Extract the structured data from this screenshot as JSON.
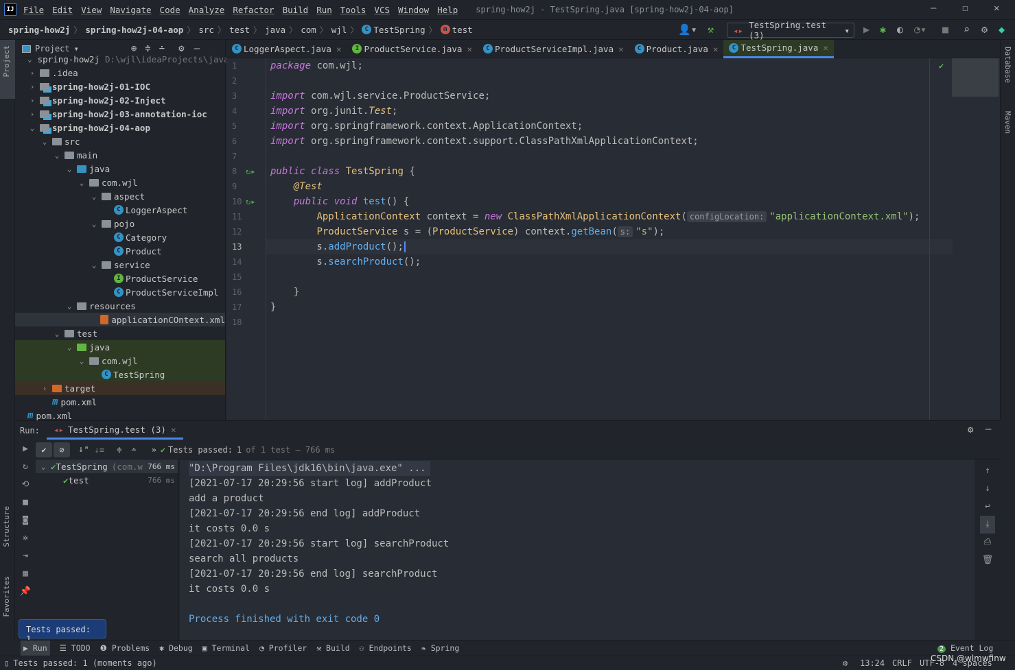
{
  "menu": {
    "logo": "IJ",
    "items": [
      "File",
      "Edit",
      "View",
      "Navigate",
      "Code",
      "Analyze",
      "Refactor",
      "Build",
      "Run",
      "Tools",
      "VCS",
      "Window",
      "Help"
    ],
    "window_title": "spring-how2j - TestSpring.java [spring-how2j-04-aop]"
  },
  "breadcrumb": [
    "spring-how2j",
    "spring-how2j-04-aop",
    "src",
    "test",
    "java",
    "com",
    "wjl",
    "TestSpring",
    "test"
  ],
  "toolbar": {
    "run_config": "TestSpring.test (3)"
  },
  "left_stripe": {
    "project": "Project",
    "structure": "Structure",
    "favorites": "Favorites"
  },
  "right_stripe": {
    "database": "Database",
    "maven": "Maven"
  },
  "project": {
    "title": "Project",
    "items": [
      {
        "d": 0,
        "a": "v",
        "i": "mod",
        "label": "spring-how2j",
        "sub": "D:\\wjl\\ideaProjects\\java"
      },
      {
        "d": 0,
        "a": ">",
        "i": "folder",
        "label": ".idea"
      },
      {
        "d": 0,
        "a": ">",
        "i": "mod",
        "label": "spring-how2j-01-IOC",
        "bold": true
      },
      {
        "d": 0,
        "a": ">",
        "i": "mod",
        "label": "spring-how2j-02-Inject",
        "bold": true
      },
      {
        "d": 0,
        "a": ">",
        "i": "mod",
        "label": "spring-how2j-03-annotation-ioc",
        "bold": true
      },
      {
        "d": 0,
        "a": "v",
        "i": "mod",
        "label": "spring-how2j-04-aop",
        "bold": true
      },
      {
        "d": 1,
        "a": "v",
        "i": "folder",
        "label": "src"
      },
      {
        "d": 2,
        "a": "v",
        "i": "folder",
        "label": "main"
      },
      {
        "d": 3,
        "a": "v",
        "i": "src",
        "label": "java"
      },
      {
        "d": 4,
        "a": "v",
        "i": "pkg",
        "label": "com.wjl"
      },
      {
        "d": 5,
        "a": "v",
        "i": "pkg",
        "label": "aspect"
      },
      {
        "d": 6,
        "a": "",
        "i": "class",
        "label": "LoggerAspect"
      },
      {
        "d": 5,
        "a": "v",
        "i": "pkg",
        "label": "pojo"
      },
      {
        "d": 6,
        "a": "",
        "i": "class",
        "label": "Category"
      },
      {
        "d": 6,
        "a": "",
        "i": "class",
        "label": "Product"
      },
      {
        "d": 5,
        "a": "v",
        "i": "pkg",
        "label": "service"
      },
      {
        "d": 6,
        "a": "",
        "i": "interface",
        "label": "ProductService"
      },
      {
        "d": 6,
        "a": "",
        "i": "class",
        "label": "ProductServiceImpl"
      },
      {
        "d": 3,
        "a": "v",
        "i": "folder",
        "label": "resources"
      },
      {
        "d": 5,
        "a": "",
        "i": "xml",
        "label": "applicationCOntext.xml",
        "sel": true
      },
      {
        "d": 2,
        "a": "v",
        "i": "folder",
        "label": "test"
      },
      {
        "d": 3,
        "a": "v",
        "i": "tsrc",
        "label": "java",
        "hl": "test"
      },
      {
        "d": 4,
        "a": "v",
        "i": "pkg",
        "label": "com.wjl",
        "hl": "test"
      },
      {
        "d": 5,
        "a": "",
        "i": "class",
        "label": "TestSpring",
        "hl": "test"
      },
      {
        "d": 1,
        "a": ">",
        "i": "target",
        "label": "target",
        "hl": "excluded"
      },
      {
        "d": 1,
        "a": "",
        "i": "maven",
        "label": "pom.xml"
      },
      {
        "d": -1,
        "a": "",
        "i": "maven",
        "label": "pom.xml"
      }
    ]
  },
  "tabs": [
    {
      "label": "LoggerAspect.java",
      "icon": "class"
    },
    {
      "label": "ProductService.java",
      "icon": "interface"
    },
    {
      "label": "ProductServiceImpl.java",
      "icon": "class"
    },
    {
      "label": "Product.java",
      "icon": "class"
    },
    {
      "label": "TestSpring.java",
      "icon": "class",
      "active": true
    }
  ],
  "editor": {
    "current_line": 13,
    "lines": [
      [
        [
          "package",
          "kw"
        ],
        [
          " com.wjl;",
          "pl"
        ]
      ],
      [],
      [
        [
          "import",
          "kw"
        ],
        [
          " com.wjl.service.ProductService;",
          "pl"
        ]
      ],
      [
        [
          "import",
          "kw"
        ],
        [
          " org.junit.",
          "pl"
        ],
        [
          "Test",
          "an"
        ],
        [
          ";",
          "pl"
        ]
      ],
      [
        [
          "import",
          "kw"
        ],
        [
          " org.springframework.context.ApplicationContext;",
          "pl"
        ]
      ],
      [
        [
          "import",
          "kw"
        ],
        [
          " org.springframework.context.support.ClassPathXmlApplicationContext;",
          "pl"
        ]
      ],
      [],
      [
        [
          "public class",
          "kw"
        ],
        [
          " ",
          "pl"
        ],
        [
          "TestSpring",
          "ty"
        ],
        [
          " {",
          "pl"
        ]
      ],
      [
        [
          "    ",
          "pl"
        ],
        [
          "@Test",
          "an"
        ]
      ],
      [
        [
          "    ",
          "pl"
        ],
        [
          "public void",
          "kw"
        ],
        [
          " ",
          "pl"
        ],
        [
          "test",
          "fn"
        ],
        [
          "() {",
          "pl"
        ]
      ],
      [
        [
          "        ",
          "pl"
        ],
        [
          "ApplicationContext",
          "ty"
        ],
        [
          " context = ",
          "pl"
        ],
        [
          "new",
          "kw"
        ],
        [
          " ",
          "pl"
        ],
        [
          "ClassPathXmlApplicationContext",
          "ty"
        ],
        [
          "(",
          "pl"
        ],
        [
          "configLocation:",
          "hint"
        ],
        [
          "\"applicationContext.xml\"",
          "st"
        ],
        [
          ");",
          "pl"
        ]
      ],
      [
        [
          "        ",
          "pl"
        ],
        [
          "ProductService",
          "ty"
        ],
        [
          " s = (",
          "pl"
        ],
        [
          "ProductService",
          "ty"
        ],
        [
          ") context.",
          "pl"
        ],
        [
          "getBean",
          "fn"
        ],
        [
          "(",
          "pl"
        ],
        [
          "s:",
          "hint"
        ],
        [
          "\"s\"",
          "st"
        ],
        [
          ");",
          "pl"
        ]
      ],
      [
        [
          "        s.",
          "pl"
        ],
        [
          "addProduct",
          "fn"
        ],
        [
          "();",
          "pl"
        ],
        [
          "",
          "caret"
        ]
      ],
      [
        [
          "        s.",
          "pl"
        ],
        [
          "searchProduct",
          "fn"
        ],
        [
          "();",
          "pl"
        ]
      ],
      [],
      [
        [
          "    }",
          "pl"
        ]
      ],
      [
        [
          "}",
          "pl"
        ]
      ],
      []
    ],
    "run_gutter_lines": [
      8,
      10
    ]
  },
  "run": {
    "label": "Run:",
    "tab": "TestSpring.test (3)",
    "status_prefix": "Tests passed:",
    "passed": "1",
    "status_suffix": "of 1 test – 766 ms",
    "tree": [
      {
        "label": "TestSpring",
        "sub": "(com.w",
        "time": "766 ms"
      },
      {
        "label": "test",
        "time": "766 ms"
      }
    ],
    "console": [
      {
        "t": "\"D:\\Program Files\\jdk16\\bin\\java.exe\" ...",
        "k": "cmd"
      },
      {
        "t": "[2021-07-17 20:29:56 start log] addProduct"
      },
      {
        "t": "add a product"
      },
      {
        "t": "[2021-07-17 20:29:56 end log] addProduct"
      },
      {
        "t": "it costs 0.0 s"
      },
      {
        "t": "[2021-07-17 20:29:56 start log] searchProduct"
      },
      {
        "t": "search all products"
      },
      {
        "t": "[2021-07-17 20:29:56 end log] searchProduct"
      },
      {
        "t": "it costs 0.0 s"
      },
      {
        "t": ""
      },
      {
        "t": "Process finished with exit code 0",
        "k": "fin"
      }
    ]
  },
  "tooltip": "Tests passed: 1",
  "bottom_tabs": [
    "Run",
    "TODO",
    "Problems",
    "Debug",
    "Terminal",
    "Profiler",
    "Build",
    "Endpoints",
    "Spring"
  ],
  "event_log": {
    "label": "Event Log",
    "count": "2"
  },
  "status": {
    "message": "Tests passed: 1 (moments ago)",
    "position": "13:24",
    "line_sep": "CRLF",
    "encoding": "UTF-8",
    "indent": "4 spaces",
    "watermark": "CSDN @wlmwfinw"
  },
  "colors": {
    "keyword": "#c678dd",
    "type": "#e5c07b",
    "method": "#61afef",
    "string": "#98c379",
    "editor_bg": "#282c34",
    "panel_bg": "#21252b",
    "accent": "#4a88e8",
    "success": "#5fb84f"
  }
}
